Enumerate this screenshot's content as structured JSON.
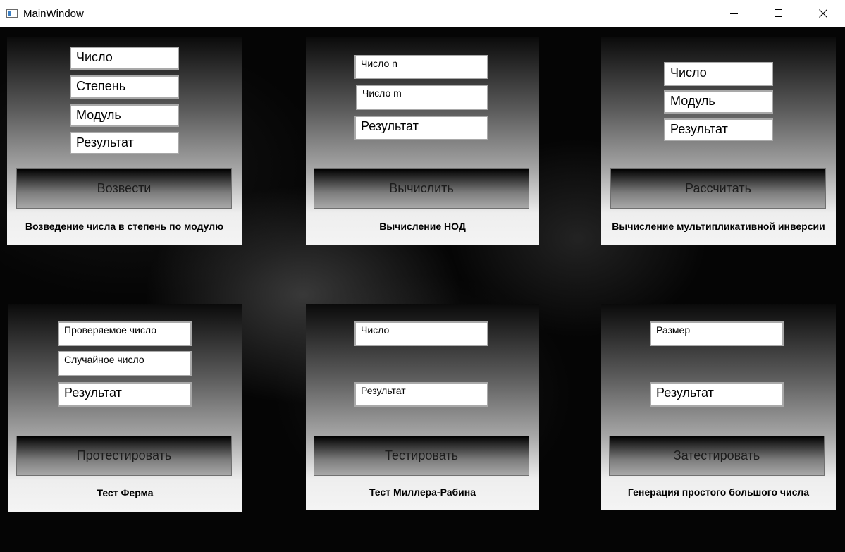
{
  "window": {
    "title": "MainWindow",
    "minimize_icon": "minimize-icon",
    "maximize_icon": "maximize-icon",
    "close_icon": "close-icon"
  },
  "panels": [
    {
      "caption": "Возведение числа в степень по модулю",
      "fields": [
        "Число",
        "Степень",
        "Модуль",
        "Результат"
      ],
      "button": "Возвести"
    },
    {
      "caption": "Вычисление НОД",
      "fields": [
        "Число n",
        "Число m",
        "Результат"
      ],
      "button": "Вычислить"
    },
    {
      "caption": "Вычисление мультипликативной инверсии",
      "fields": [
        "Число",
        "Модуль",
        "Результат"
      ],
      "button": "Рассчитать"
    },
    {
      "caption": "Тест Ферма",
      "fields": [
        "Проверяемое число",
        "Случайное число",
        "Результат"
      ],
      "button": "Протестировать"
    },
    {
      "caption": "Тест Миллера-Рабина",
      "fields": [
        "Число",
        "Результат"
      ],
      "button": "Тестировать"
    },
    {
      "caption": "Генерация простого большого числа",
      "fields": [
        "Размер",
        "Результат"
      ],
      "button": "Затестировать"
    }
  ]
}
